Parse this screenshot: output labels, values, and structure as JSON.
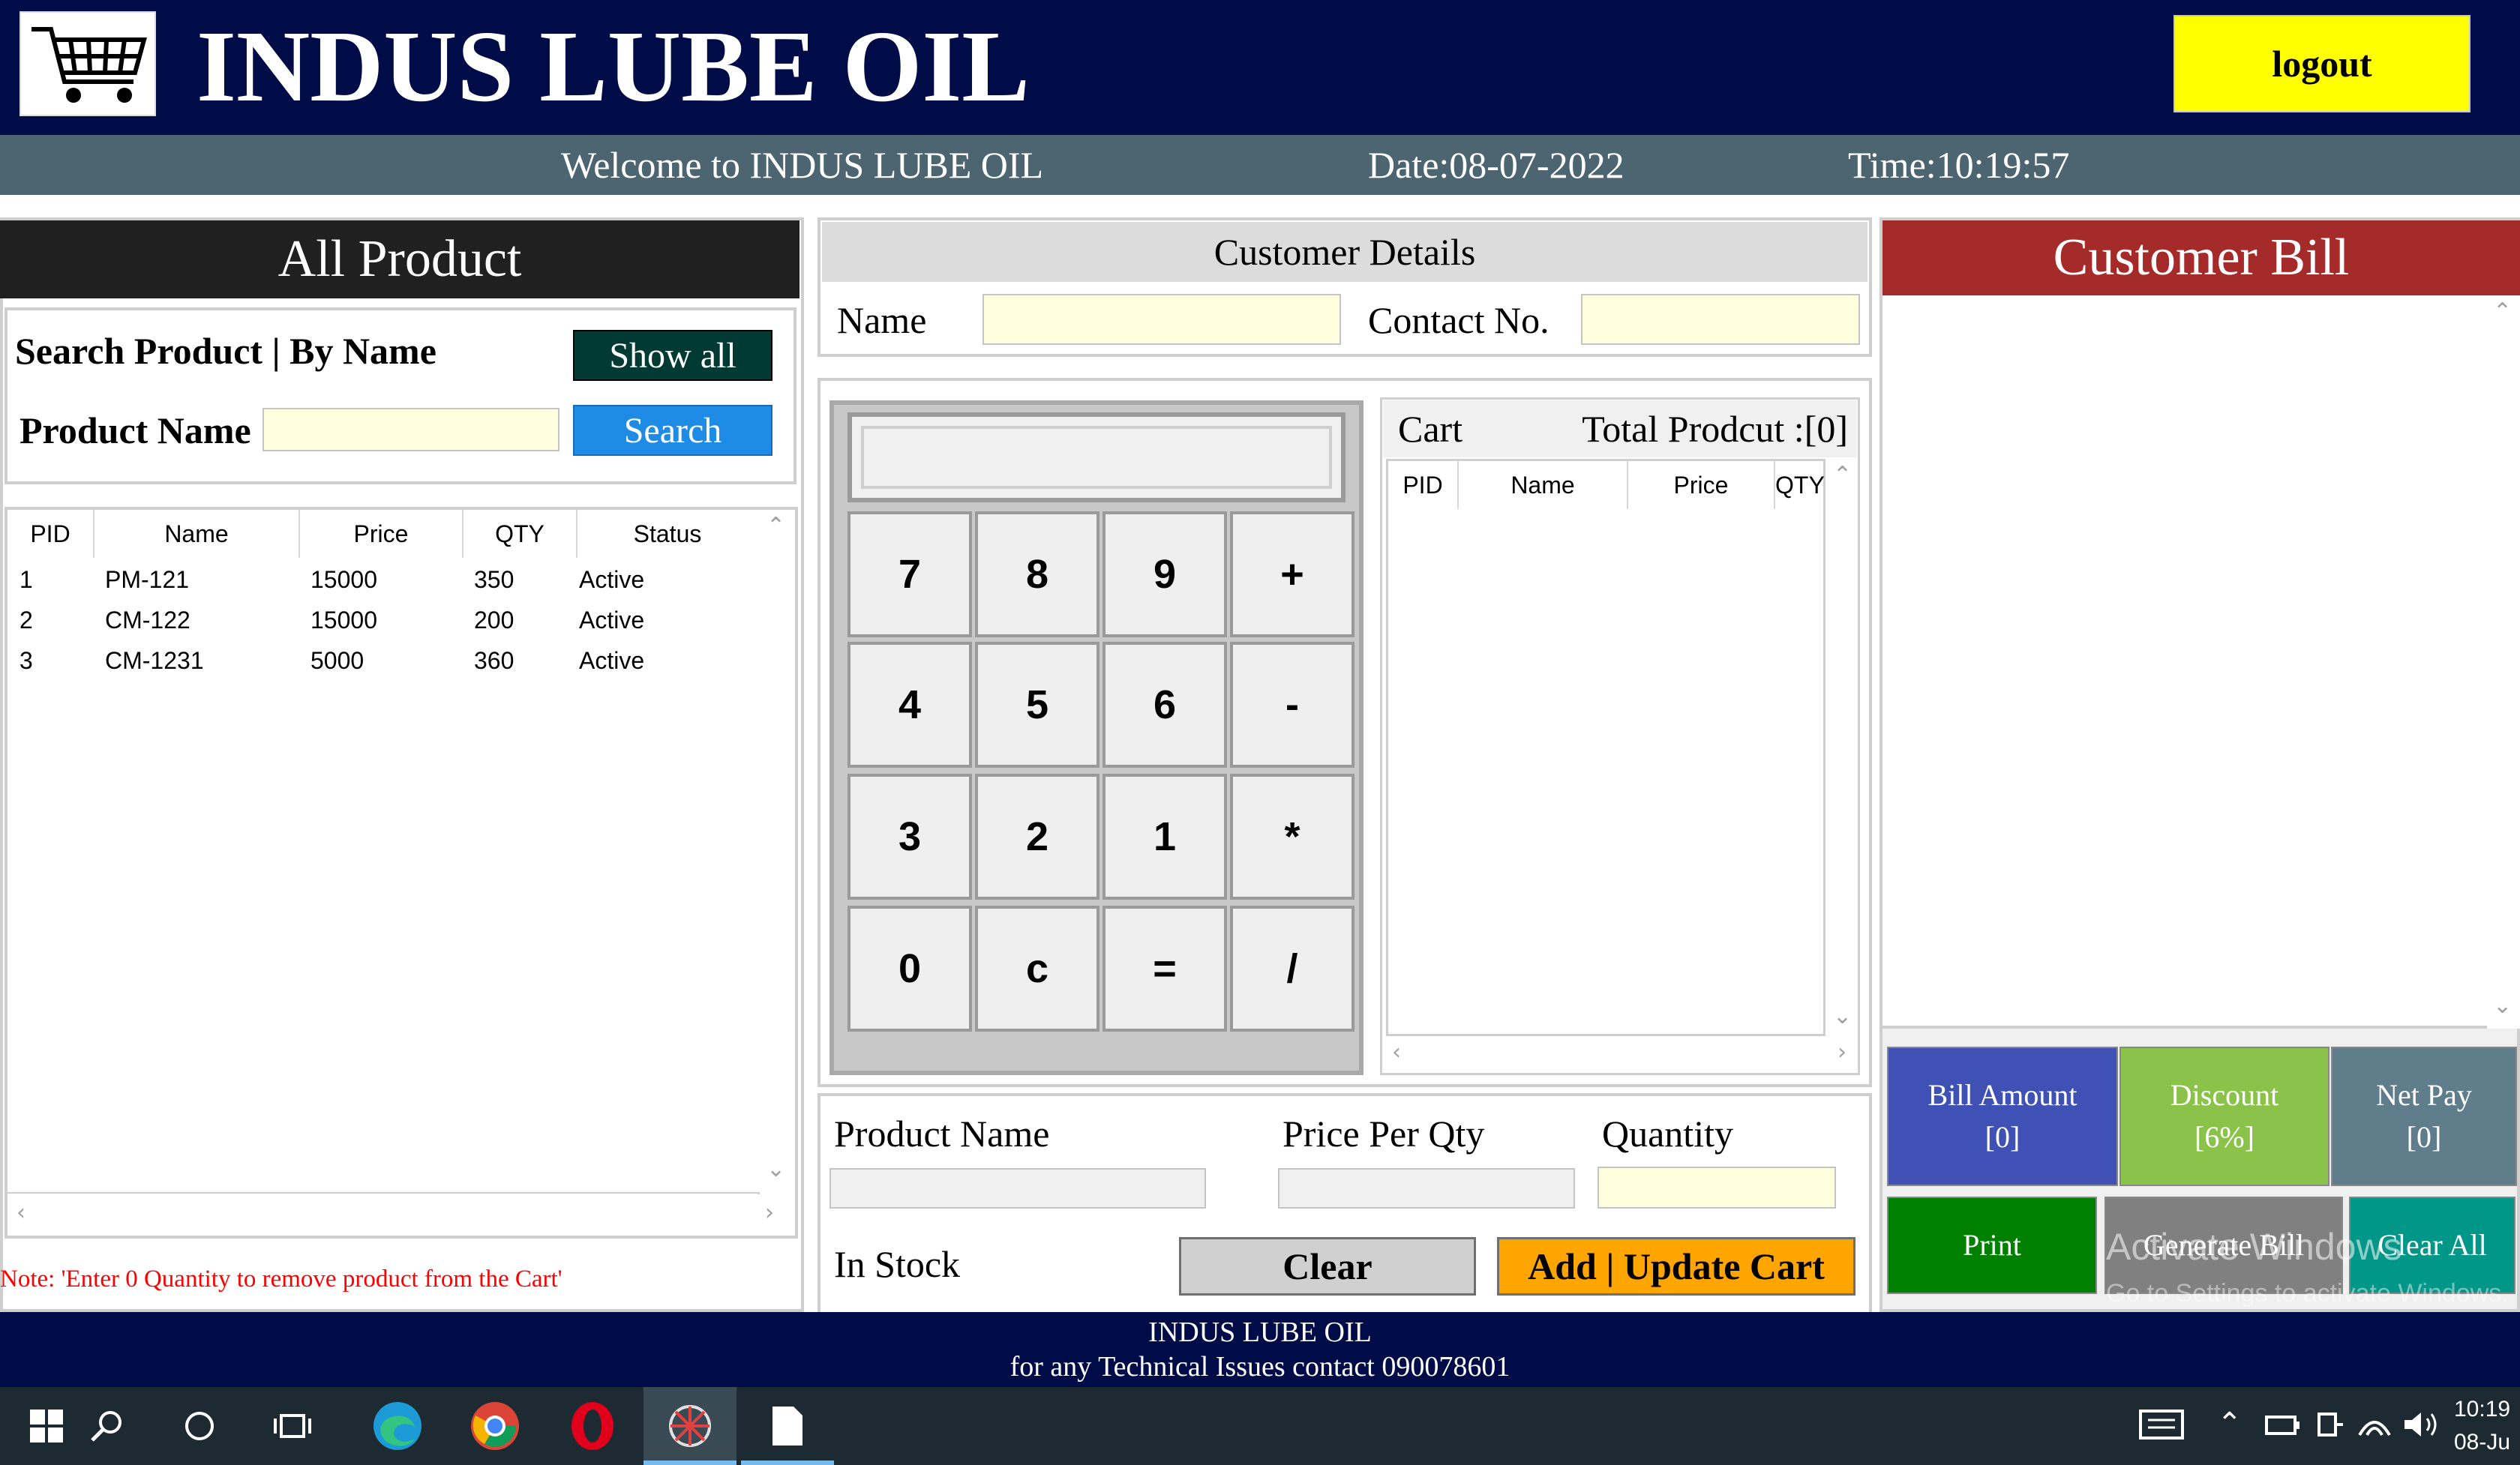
{
  "header": {
    "title": "INDUS LUBE OIL",
    "logout_label": "logout",
    "logo_icon": "shopping-cart-icon"
  },
  "infobar": {
    "welcome": "Welcome to INDUS LUBE OIL",
    "date": "Date:08-07-2022",
    "time": "Time:10:19:57"
  },
  "products": {
    "title": "All Product",
    "search_heading": "Search Product | By Name",
    "show_all_label": "Show all",
    "product_name_label": "Product Name",
    "search_label": "Search",
    "columns": [
      "PID",
      "Name",
      "Price",
      "QTY",
      "Status"
    ],
    "rows": [
      {
        "pid": "1",
        "name": "PM-121",
        "price": "15000",
        "qty": "350",
        "status": "Active"
      },
      {
        "pid": "2",
        "name": "CM-122",
        "price": "15000",
        "qty": "200",
        "status": "Active"
      },
      {
        "pid": "3",
        "name": "CM-1231",
        "price": "5000",
        "qty": "360",
        "status": "Active"
      }
    ],
    "note": "Note: 'Enter 0 Quantity to remove product from the Cart'"
  },
  "customer": {
    "title": "Customer Details",
    "name_label": "Name",
    "contact_label": "Contact No."
  },
  "calculator": {
    "keys": [
      "7",
      "8",
      "9",
      "+",
      "4",
      "5",
      "6",
      "-",
      "3",
      "2",
      "1",
      "*",
      "0",
      "c",
      "=",
      "/"
    ]
  },
  "cart": {
    "title": "Cart",
    "total_label": "Total Prodcut :[0]",
    "columns": [
      "PID",
      "Name",
      "Price",
      "QTY"
    ]
  },
  "entry": {
    "product_name_label": "Product Name",
    "price_label": "Price Per Qty",
    "quantity_label": "Quantity",
    "in_stock_label": "In Stock",
    "clear_label": "Clear",
    "add_label": "Add | Update Cart"
  },
  "bill": {
    "title": "Customer Bill",
    "bill_amount_label": "Bill Amount",
    "bill_amount_value": "[0]",
    "discount_label": "Discount",
    "discount_value": "[6%]",
    "net_pay_label": "Net Pay",
    "net_pay_value": "[0]",
    "print_label": "Print",
    "generate_label": "Generate Bill",
    "clear_all_label": "Clear All"
  },
  "footer": {
    "line1": "INDUS LUBE OIL",
    "line2": "for any Technical Issues contact 090078601"
  },
  "watermark": {
    "line1": "Activate Windows",
    "line2": "Go to Settings to activate Windows."
  },
  "taskbar": {
    "icons": [
      "windows-start-icon",
      "search-icon",
      "cortana-icon",
      "task-view-icon",
      "edge-icon",
      "chrome-icon",
      "opera-icon",
      "app-icon",
      "notepad-icon"
    ],
    "clock_time": "10:19",
    "clock_date": "08-Ju"
  },
  "colors": {
    "header_bg": "#000c47",
    "infobar_bg": "#4c6570",
    "logout_bg": "#ffff00",
    "show_all_bg": "#003a32",
    "search_bg": "#1e8ce6",
    "bill_title_bg": "#a52a2a",
    "bill_amount_bg": "#3f51b5",
    "discount_bg": "#8bc34a",
    "net_pay_bg": "#607d8b",
    "print_bg": "#008000",
    "generate_bg": "#808080",
    "clear_all_bg": "#009688",
    "add_cart_bg": "#ffa500"
  }
}
